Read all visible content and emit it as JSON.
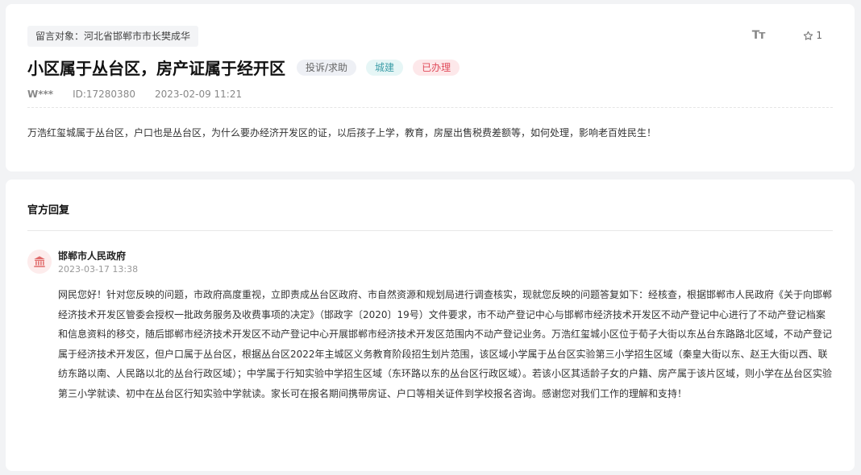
{
  "message": {
    "target": "留言对象：河北省邯郸市市长樊成华",
    "title": "小区属于丛台区，房产证属于经开区",
    "badges": {
      "type": "投诉/求助",
      "field": "城建",
      "status": "已办理"
    },
    "author": "W***",
    "id": "ID:17280380",
    "time": "2023-02-09 11:21",
    "content": "万浩红玺城属于丛台区，户口也是丛台区，为什么要办经济开发区的证，以后孩子上学，教育，房屋出售税费差额等，如何处理，影响老百姓民生！"
  },
  "tools": {
    "font_size_glyph": "Tт",
    "favorite_count": "1",
    "icons": {
      "font_size": "font-size-icon",
      "favorite": "star-icon"
    }
  },
  "reply": {
    "heading": "官方回复",
    "org": "邯郸市人民政府",
    "time": "2023-03-17 13:38",
    "avatar_icon": "government-building-icon",
    "text": "网民您好！针对您反映的问题，市政府高度重视，立即责成丛台区政府、市自然资源和规划局进行调查核实，现就您反映的问题答复如下：经核查，根据邯郸市人民政府《关于向邯郸经济技术开发区管委会授权一批政务服务及收费事项的决定》（邯政字〔2020〕19号）文件要求，市不动产登记中心与邯郸市经济技术开发区不动产登记中心进行了不动产登记档案和信息资料的移交，随后邯郸市经济技术开发区不动产登记中心开展邯郸市经济技术开发区范围内不动产登记业务。万浩红玺城小区位于荀子大街以东丛台东路路北区域，不动产登记属于经济技术开发区，但户口属于丛台区，根据丛台区2022年主城区义务教育阶段招生划片范围，该区域小学属于丛台区实验第三小学招生区域（秦皇大街以东、赵王大街以西、联纺东路以南、人民路以北的丛台行政区域）；中学属于行知实验中学招生区域（东环路以东的丛台区行政区域）。若该小区其适龄子女的户籍、房产属于该片区域，则小学在丛台区实验第三小学就读、初中在丛台区行知实验中学就读。家长可在报名期间携带房证、户口等相关证件到学校报名咨询。感谢您对我们工作的理解和支持！"
  },
  "colors": {
    "status_red": "#e04b5a",
    "field_teal": "#3e9ea8",
    "avatar_bg": "#fdecec",
    "avatar_icon": "#e06a6a"
  }
}
